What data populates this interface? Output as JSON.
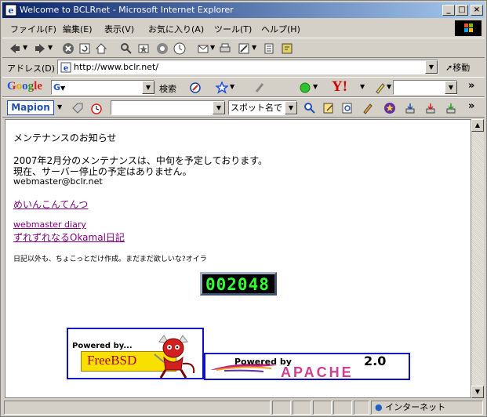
{
  "window": {
    "title": "Welcome to BCLRnet - Microsoft Internet Explorer",
    "minimize": "_",
    "maximize": "□",
    "close": "×"
  },
  "menu": [
    "ファイル(F)",
    "編集(E)",
    "表示(V)",
    "お気に入り(A)",
    "ツール(T)",
    "ヘルプ(H)"
  ],
  "address": {
    "label": "アドレス(D)",
    "url": "http://www.bclr.net/",
    "go_label": "移動"
  },
  "google_toolbar": {
    "logo": "Google",
    "search_button": "検索",
    "more": "»"
  },
  "mapion_toolbar": {
    "logo": "Mapion",
    "spot_select": "スポット名で",
    "more": "»"
  },
  "page": {
    "heading": "メンテナンスのお知らせ",
    "line1": "2007年2月分のメンテナンスは、中旬を予定しております。",
    "line2": "現在、サーバー停止の予定はありません。",
    "email": "webmaster@bclr.net",
    "link1": "めいんこんてんつ",
    "link2": "webmaster diary",
    "link3": "ずれずれなるOkamal日記",
    "small_note": "日記以外も、ちょこっとだけ作成。まだまだ欲しいな?オイラ",
    "counter": "002048",
    "freebsd_badge": {
      "line1": "Powered by...",
      "line2": "FreeBSD"
    },
    "apache_badge": {
      "line1": "Powered by",
      "version": "2.0",
      "name": "APACHE"
    }
  },
  "status": {
    "zone": "インターネット"
  },
  "colors": {
    "titlebar_start": "#0a246a",
    "link_visited": "#800080",
    "counter_digits": "#33ff33",
    "badge_border": "#1010c0"
  }
}
